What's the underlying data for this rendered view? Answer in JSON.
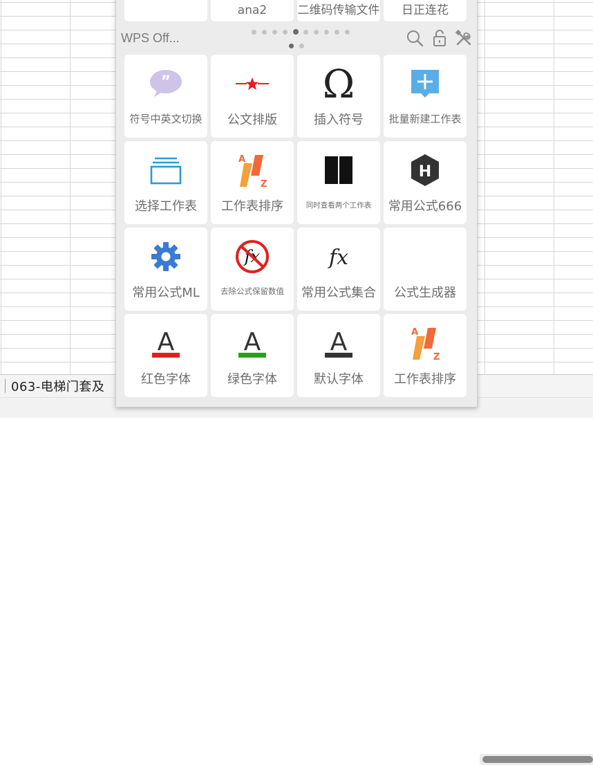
{
  "sheet": {
    "tab_label": "063-电梯门套及"
  },
  "panel": {
    "title": "WPS Off...",
    "top_tiles": [
      {
        "label": ""
      },
      {
        "label": "ana2"
      },
      {
        "label": "二维码传输文件"
      },
      {
        "label": "日正连花"
      }
    ],
    "page_dots": {
      "row1_count": 10,
      "row1_active": 5,
      "row2_count": 2,
      "row2_active": 1
    },
    "header_icons": [
      "search-icon",
      "unlock-icon",
      "tools-icon"
    ],
    "tiles": [
      {
        "label": "符号中英文切换",
        "icon": "quote-bubble-icon"
      },
      {
        "label": "公文排版",
        "icon": "red-star-line-icon"
      },
      {
        "label": "插入符号",
        "icon": "omega-icon"
      },
      {
        "label": "批量新建工作表",
        "icon": "plus-note-icon"
      },
      {
        "label": "选择工作表",
        "icon": "stacked-sheets-icon"
      },
      {
        "label": "工作表排序",
        "icon": "sort-az-icon"
      },
      {
        "label": "同时查看两个工作表",
        "icon": "two-columns-icon"
      },
      {
        "label": "常用公式666",
        "icon": "hexagon-h-icon"
      },
      {
        "label": "常用公式ML",
        "icon": "gear-icon"
      },
      {
        "label": "去除公式保留数值",
        "icon": "no-fx-icon"
      },
      {
        "label": "常用公式集合",
        "icon": "fx-icon"
      },
      {
        "label": "公式生成器",
        "icon": ""
      },
      {
        "label": "红色字体",
        "icon": "font-red-icon"
      },
      {
        "label": "绿色字体",
        "icon": "font-green-icon"
      },
      {
        "label": "默认字体",
        "icon": "font-default-icon"
      },
      {
        "label": "工作表排序",
        "icon": "sort-az-icon"
      }
    ]
  },
  "colors": {
    "panel_bg": "#ececec",
    "tile_bg": "#ffffff",
    "label": "#6e6e6e",
    "red": "#e02020",
    "green": "#2aa01e",
    "blue": "#3a8ee6",
    "orange": "#f08a2a"
  }
}
